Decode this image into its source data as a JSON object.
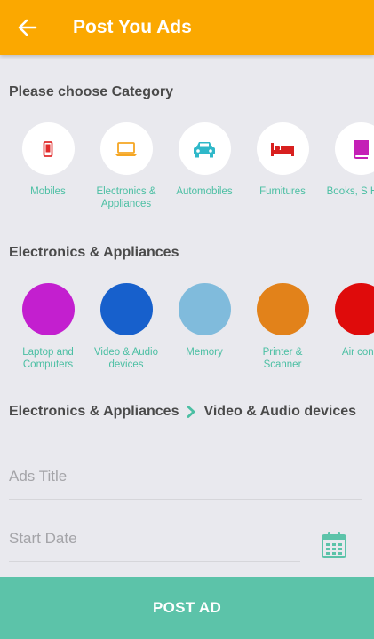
{
  "header": {
    "title": "Post You Ads",
    "back_icon": "arrow-left-icon",
    "bg_color": "#fba800"
  },
  "category_section": {
    "title": "Please choose Category",
    "items": [
      {
        "label": "Mobiles",
        "icon": "mobile-phone-icon",
        "icon_color": "#e12c2c"
      },
      {
        "label": "Electronics & Appliances",
        "icon": "laptop-icon",
        "icon_color": "#f5a623"
      },
      {
        "label": "Automobiles",
        "icon": "car-icon",
        "icon_color": "#2fb8c9"
      },
      {
        "label": "Furnitures",
        "icon": "bed-icon",
        "icon_color": "#d8201f"
      },
      {
        "label": "Books, S Hobb",
        "icon": "book-icon",
        "icon_color": "#c41fb6"
      }
    ]
  },
  "subcategory_section": {
    "title": "Electronics & Appliances",
    "items": [
      {
        "label": "Laptop and Computers",
        "color": "#c31fcf"
      },
      {
        "label": "Video & Audio devices",
        "color": "#1760cc"
      },
      {
        "label": "Memory",
        "color": "#80bbdc"
      },
      {
        "label": "Printer & Scanner",
        "color": "#e2821a"
      },
      {
        "label": "Air cond",
        "color": "#df0b0b"
      }
    ]
  },
  "breadcrumb": {
    "parent": "Electronics & Appliances",
    "child": "Video & Audio devices",
    "separator_icon": "chevron-right-icon"
  },
  "form": {
    "ads_title_placeholder": "Ads Title",
    "start_date_placeholder": "Start Date",
    "calendar_icon": "calendar-icon"
  },
  "post_button": {
    "label": "POST AD",
    "color": "#5cc3a9"
  },
  "accent_color": "#4bbfa3"
}
